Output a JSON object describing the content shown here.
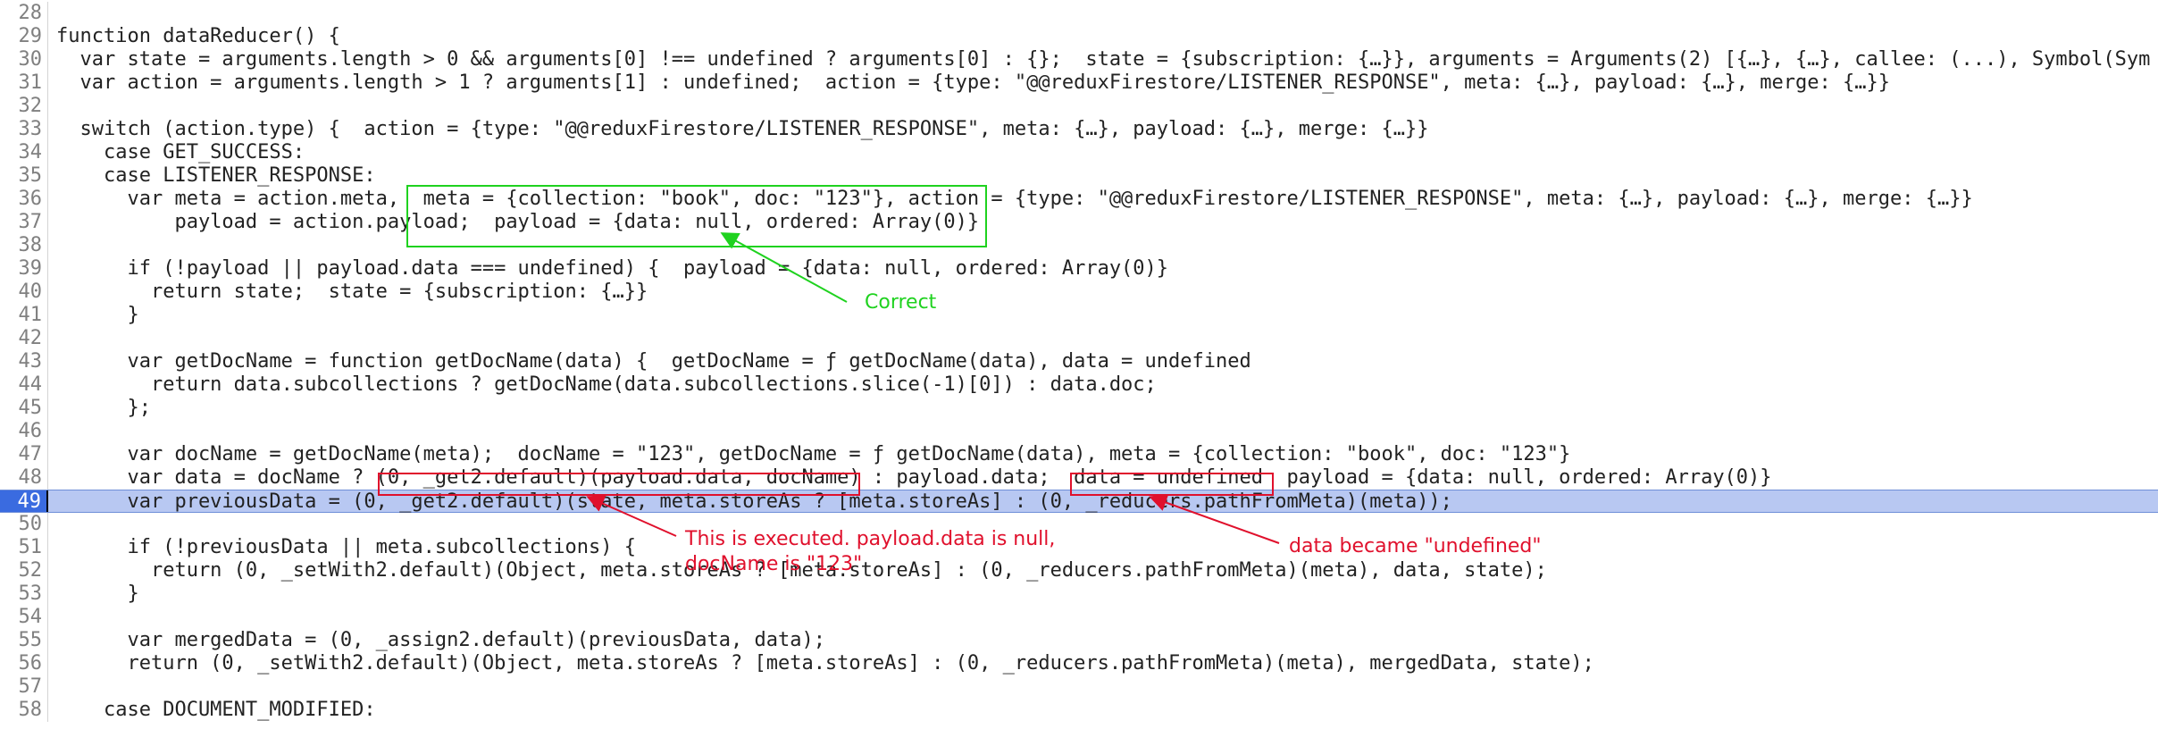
{
  "editor": {
    "lines": [
      {
        "num": "28",
        "code": ""
      },
      {
        "num": "29",
        "code": "function dataReducer() {"
      },
      {
        "num": "30",
        "code": "  var state = arguments.length > 0 && arguments[0] !== undefined ? arguments[0] : {};  state = {subscription: {…}}, arguments = Arguments(2) [{…}, {…}, callee: (...), Symbol(Sym"
      },
      {
        "num": "31",
        "code": "  var action = arguments.length > 1 ? arguments[1] : undefined;  action = {type: \"@@reduxFirestore/LISTENER_RESPONSE\", meta: {…}, payload: {…}, merge: {…}}"
      },
      {
        "num": "32",
        "code": ""
      },
      {
        "num": "33",
        "code": "  switch (action.type) {  action = {type: \"@@reduxFirestore/LISTENER_RESPONSE\", meta: {…}, payload: {…}, merge: {…}}"
      },
      {
        "num": "34",
        "code": "    case GET_SUCCESS:"
      },
      {
        "num": "35",
        "code": "    case LISTENER_RESPONSE:"
      },
      {
        "num": "36",
        "code": "      var meta = action.meta,  meta = {collection: \"book\", doc: \"123\"}, action = {type: \"@@reduxFirestore/LISTENER_RESPONSE\", meta: {…}, payload: {…}, merge: {…}}"
      },
      {
        "num": "37",
        "code": "          payload = action.payload;  payload = {data: null, ordered: Array(0)}"
      },
      {
        "num": "38",
        "code": ""
      },
      {
        "num": "39",
        "code": "      if (!payload || payload.data === undefined) {  payload = {data: null, ordered: Array(0)}"
      },
      {
        "num": "40",
        "code": "        return state;  state = {subscription: {…}}"
      },
      {
        "num": "41",
        "code": "      }"
      },
      {
        "num": "42",
        "code": ""
      },
      {
        "num": "43",
        "code": "      var getDocName = function getDocName(data) {  getDocName = ƒ getDocName(data), data = undefined"
      },
      {
        "num": "44",
        "code": "        return data.subcollections ? getDocName(data.subcollections.slice(-1)[0]) : data.doc;"
      },
      {
        "num": "45",
        "code": "      };"
      },
      {
        "num": "46",
        "code": ""
      },
      {
        "num": "47",
        "code": "      var docName = getDocName(meta);  docName = \"123\", getDocName = ƒ getDocName(data), meta = {collection: \"book\", doc: \"123\"}"
      },
      {
        "num": "48",
        "code": "      var data = docName ? (0, _get2.default)(payload.data, docName) : payload.data;  data = undefined  payload = {data: null, ordered: Array(0)}"
      },
      {
        "num": "49",
        "code": "      var previousData = (0, _get2.default)(state, meta.storeAs ? [meta.storeAs] : (0, _reducers.pathFromMeta)(meta));"
      },
      {
        "num": "50",
        "code": ""
      },
      {
        "num": "51",
        "code": "      if (!previousData || meta.subcollections) {"
      },
      {
        "num": "52",
        "code": "        return (0, _setWith2.default)(Object, meta.storeAs ? [meta.storeAs] : (0, _reducers.pathFromMeta)(meta), data, state);"
      },
      {
        "num": "53",
        "code": "      }"
      },
      {
        "num": "54",
        "code": ""
      },
      {
        "num": "55",
        "code": "      var mergedData = (0, _assign2.default)(previousData, data);"
      },
      {
        "num": "56",
        "code": "      return (0, _setWith2.default)(Object, meta.storeAs ? [meta.storeAs] : (0, _reducers.pathFromMeta)(meta), mergedData, state);"
      },
      {
        "num": "57",
        "code": ""
      },
      {
        "num": "58",
        "code": "    case DOCUMENT_MODIFIED:"
      }
    ],
    "current_line": "49"
  },
  "annotations": {
    "correct": "Correct",
    "executed": "This is executed. payload.data is null,\ndocName is \"123\"",
    "undefined_note": "data became \"undefined\""
  },
  "colors": {
    "green": "#1fd21f",
    "red": "#e0102c",
    "highlight": "#b8c8f2"
  }
}
